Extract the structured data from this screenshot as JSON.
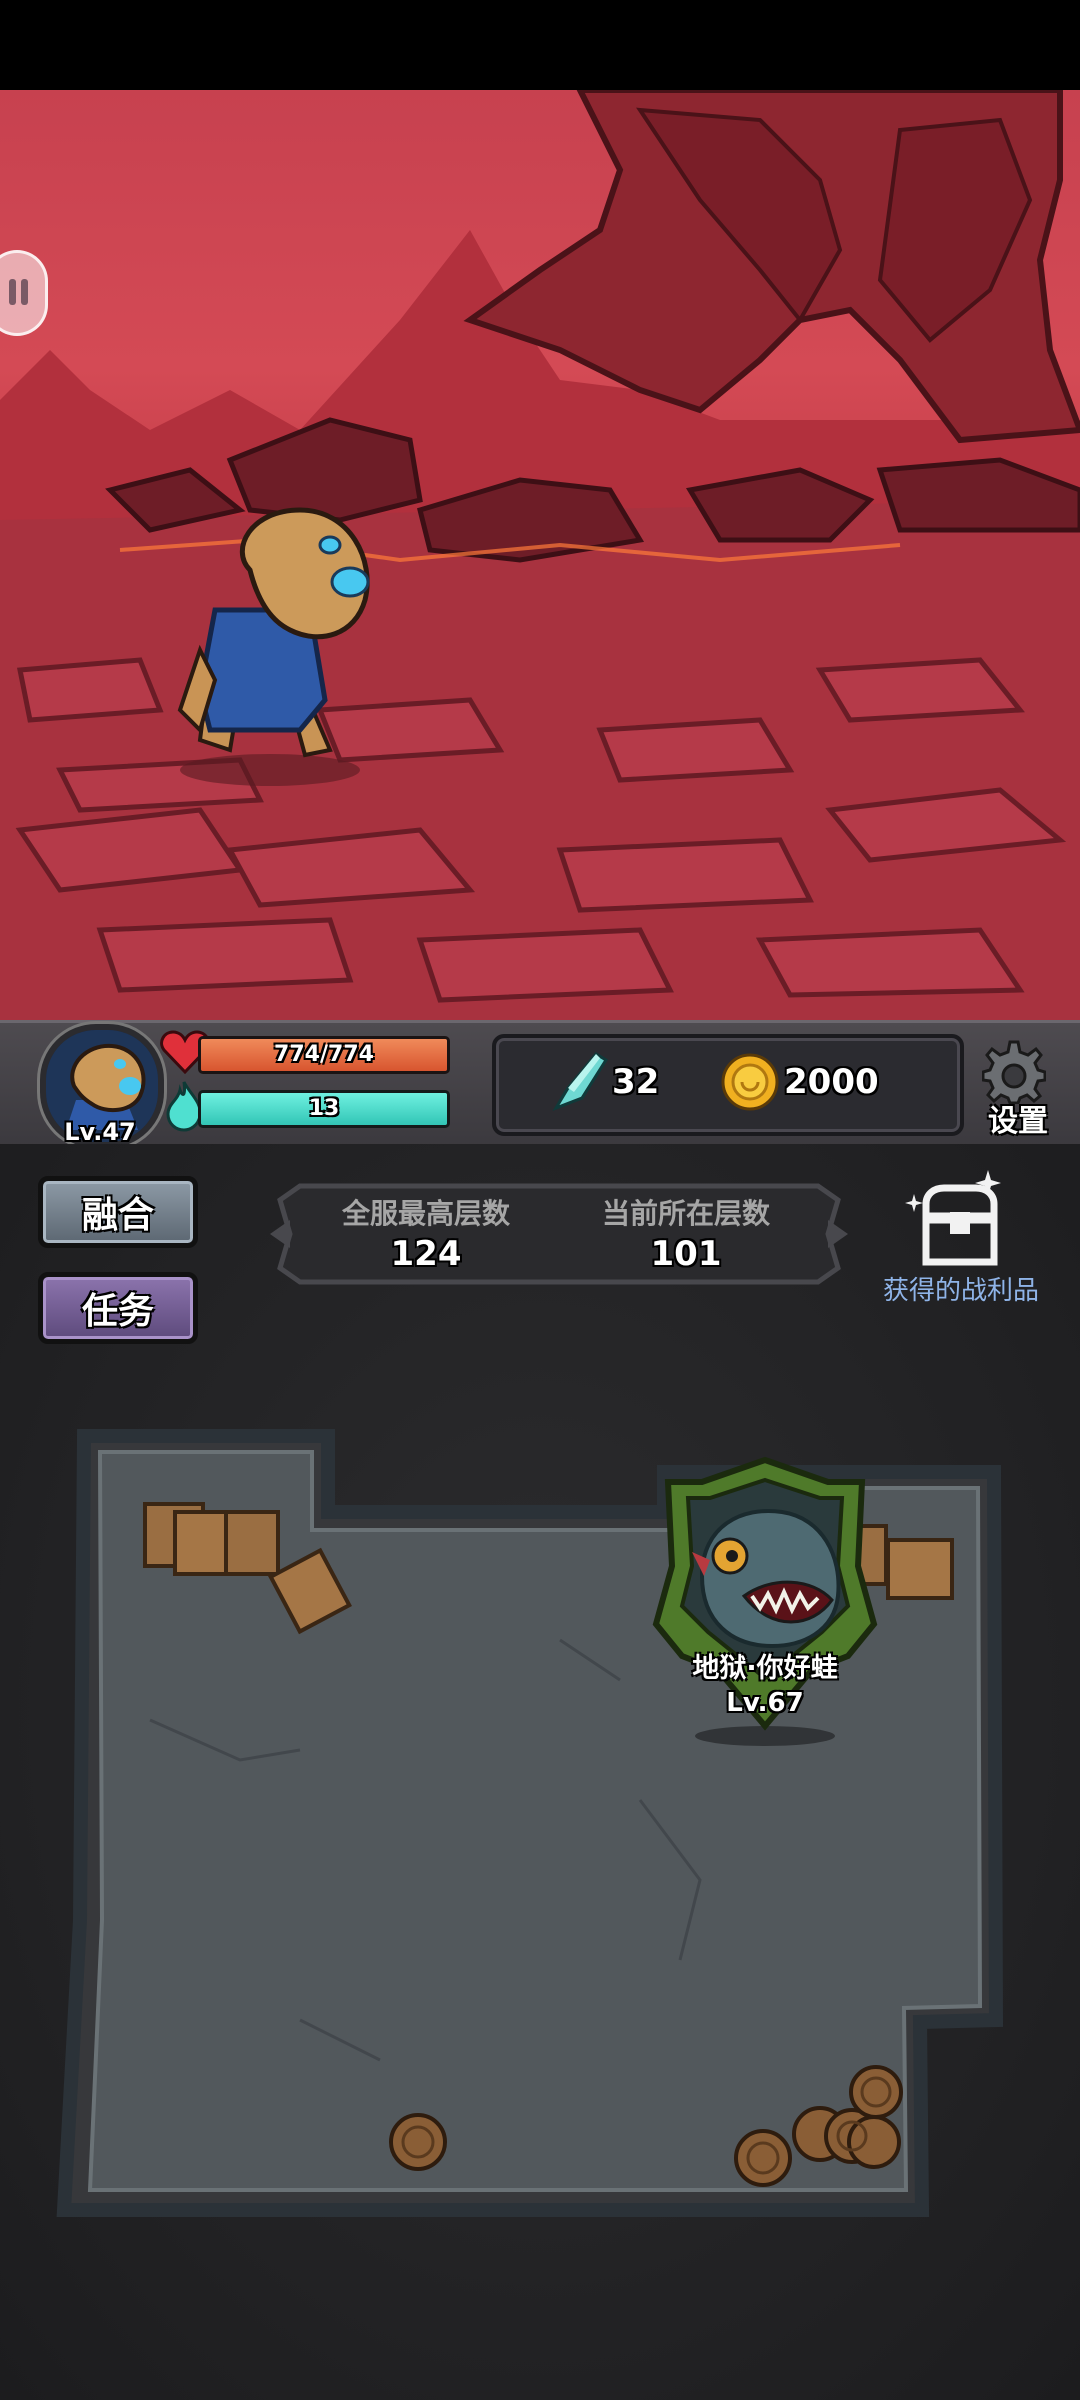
{
  "player": {
    "level": "Lv.47",
    "hp_text": "774/774",
    "hp_fraction": 1.0,
    "mana_text": "13",
    "mana_fraction": 1.0
  },
  "currency": {
    "gems": "32",
    "coins": "2000"
  },
  "settings": {
    "label": "设置"
  },
  "side_buttons": {
    "fuse_label": "融合",
    "task_label": "任务"
  },
  "floors": {
    "server_highest_label": "全服最高层数",
    "server_highest_value": "124",
    "current_label": "当前所在层数",
    "current_value": "101"
  },
  "loot": {
    "label": "获得的战利品"
  },
  "boss": {
    "name": "地狱·你好蛙",
    "level": "Lv.67"
  },
  "colors": {
    "scene_red": "#c7414f",
    "hp_orange": "#d8552f",
    "mana_teal": "#32c6b6",
    "loot_blue": "#8fb4e8",
    "boss_green": "#4f7a2a"
  }
}
